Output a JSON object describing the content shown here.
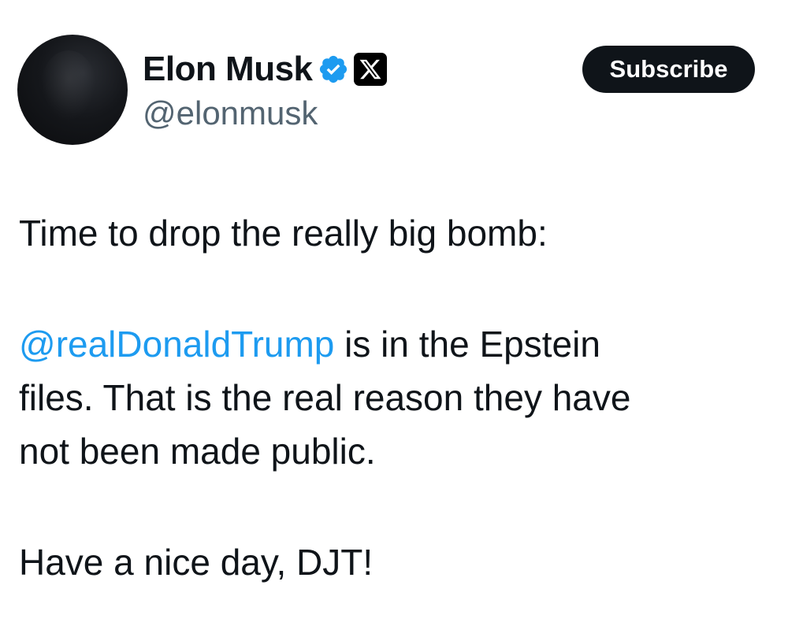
{
  "author": {
    "display_name": "Elon Musk",
    "handle": "@elonmusk",
    "verified_icon": "verified-badge-icon",
    "affiliate_icon": "x-logo-icon"
  },
  "actions": {
    "subscribe_label": "Subscribe"
  },
  "tweet": {
    "line1": "Time to drop the really big bomb:",
    "mention": "@realDonaldTrump",
    "line2_rest": " is in the Epstein",
    "line3": "files. That is the real reason they have",
    "line4": "not been made public.",
    "line5": "Have a nice day, DJT!"
  },
  "colors": {
    "text": "#0f1419",
    "secondary_text": "#536471",
    "link": "#1d9bf0",
    "verified": "#1d9bf0",
    "button_bg": "#0f1419",
    "button_text": "#ffffff"
  }
}
